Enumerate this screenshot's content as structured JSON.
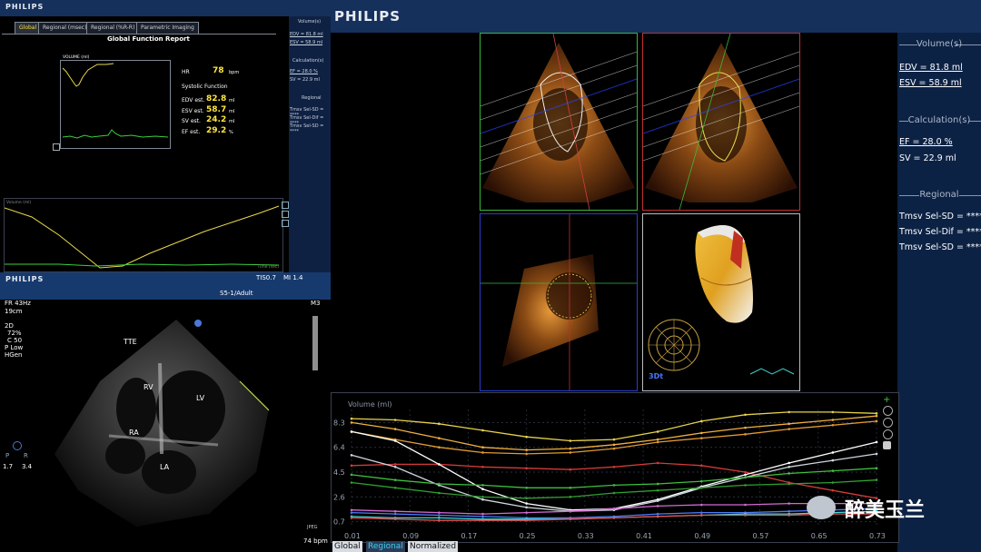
{
  "brand": "PHILIPS",
  "report": {
    "tabs": [
      "Global",
      "Regional (msec)",
      "Regional (%R-R)",
      "Parametric Imaging"
    ],
    "active_tab": 0,
    "title": "Global Function Report",
    "volume_label": "VOLUME (ml)",
    "hr_label": "HR",
    "hr_value": "78",
    "hr_unit": "bpm",
    "systolic_heading": "Systolic Function",
    "metrics": [
      {
        "label": "EDV est.",
        "value": "82.8",
        "unit": "ml"
      },
      {
        "label": "ESV est.",
        "value": "58.7",
        "unit": "ml"
      },
      {
        "label": "SV est.",
        "value": "24.2",
        "unit": "ml"
      },
      {
        "label": "EF est.",
        "value": "29.2",
        "unit": "%"
      }
    ],
    "side": {
      "volume_head": "Volume(s)",
      "edv": "EDV = 81.8 ml",
      "esv": "ESV = 58.9 ml",
      "calc_head": "Calculation(s)",
      "ef": "EF = 28.0 %",
      "sv": "SV = 22.9 ml",
      "regional_head": "Regional",
      "items": [
        "Tmsv Sel-SD = ****",
        "Tmsv Sel-Dif = ****",
        "Tmsv Sel-SD = ****"
      ]
    },
    "mini_axis": "Volume (ml)",
    "mini_time": "Time (sec)",
    "footer_tis": "TIS0.7",
    "footer_mi": "MI 1.4",
    "footer_preset": "S5-1/Adult"
  },
  "echo": {
    "fr": "FR 43Hz",
    "depth": "19cm",
    "mode": "2D",
    "gain": "72%",
    "comp": "C 50",
    "power": "P Low",
    "gen": "HGen",
    "m3": "M3",
    "probe": "TTE",
    "chambers": [
      "RV",
      "LV",
      "RA",
      "LA"
    ],
    "pr_p": "P",
    "pr_r": "R",
    "pr_left": "1.7",
    "pr_right": "3.4",
    "jpeg": "JPEG",
    "bpm": "74 bpm"
  },
  "main": {
    "side": {
      "volume_head": "Volume(s)",
      "edv": "EDV = 81.8 ml",
      "esv": "ESV = 58.9 ml",
      "calc_head": "Calculation(s)",
      "ef": "EF = 28.0 %",
      "sv": "SV = 22.9 ml",
      "regional_head": "Regional",
      "items": [
        "Tmsv Sel-SD = ****",
        "Tmsv Sel-Dif = ****",
        "Tmsv Sel-SD = ****"
      ]
    },
    "badge_3d": "3Dt",
    "bullseye_labels": [
      "1",
      "2",
      "3",
      "4",
      "5",
      "6"
    ],
    "bottom_tabs": [
      "Global",
      "Regional",
      "Normalized"
    ],
    "active_bottom_tab": 1,
    "watermark": "醉美玉兰"
  },
  "chart_data": {
    "type": "line",
    "ylabel": "Volume (ml)",
    "y_ticks": [
      "8.3",
      "6.4",
      "4.5",
      "2.6",
      "0.7"
    ],
    "x_ticks": [
      "0.01",
      "0.09",
      "0.17",
      "0.25",
      "0.33",
      "0.41",
      "0.49",
      "0.57",
      "0.65",
      "0.73"
    ],
    "ylim": [
      0.4,
      9.3
    ],
    "xlim": [
      0.01,
      0.73
    ],
    "series": [
      {
        "color": "#e6d34a",
        "values": [
          8.6,
          8.5,
          8.2,
          7.7,
          7.2,
          6.9,
          7.0,
          7.6,
          8.4,
          8.9,
          9.1,
          9.1,
          9.0
        ]
      },
      {
        "color": "#f0b040",
        "values": [
          8.3,
          7.8,
          7.1,
          6.4,
          6.2,
          6.3,
          6.6,
          7.0,
          7.5,
          7.9,
          8.2,
          8.5,
          8.8
        ]
      },
      {
        "color": "#e09a30",
        "values": [
          7.6,
          7.0,
          6.4,
          6.0,
          5.9,
          6.0,
          6.3,
          6.8,
          7.1,
          7.4,
          7.8,
          8.1,
          8.4
        ]
      },
      {
        "color": "#d43a3a",
        "values": [
          5.0,
          5.1,
          5.1,
          4.9,
          4.8,
          4.7,
          4.9,
          5.2,
          5.0,
          4.5,
          3.7,
          3.1,
          2.5
        ]
      },
      {
        "color": "#ffffff",
        "values": [
          7.6,
          6.9,
          5.1,
          3.2,
          2.1,
          1.6,
          1.7,
          2.4,
          3.4,
          4.3,
          5.2,
          6.0,
          6.8
        ]
      },
      {
        "color": "#cfd6e0",
        "values": [
          5.8,
          4.9,
          3.5,
          2.4,
          1.8,
          1.5,
          1.6,
          2.3,
          3.3,
          4.1,
          4.9,
          5.4,
          5.9
        ]
      },
      {
        "color": "#3fbf3f",
        "values": [
          4.3,
          3.9,
          3.6,
          3.5,
          3.3,
          3.3,
          3.5,
          3.6,
          3.8,
          4.1,
          4.4,
          4.6,
          4.8
        ]
      },
      {
        "color": "#2fa02f",
        "values": [
          3.7,
          3.3,
          2.9,
          2.6,
          2.5,
          2.6,
          2.9,
          3.1,
          3.3,
          3.5,
          3.6,
          3.7,
          3.9
        ]
      },
      {
        "color": "#d46ad4",
        "values": [
          1.6,
          1.5,
          1.4,
          1.3,
          1.4,
          1.5,
          1.7,
          1.9,
          2.0,
          2.0,
          2.1,
          2.1,
          2.1
        ]
      },
      {
        "color": "#4d7dff",
        "values": [
          1.4,
          1.3,
          1.2,
          1.1,
          1.0,
          1.0,
          1.1,
          1.3,
          1.4,
          1.4,
          1.5,
          1.6,
          1.7
        ]
      },
      {
        "color": "#40d8d8",
        "values": [
          1.1,
          1.0,
          1.0,
          0.9,
          0.9,
          0.9,
          1.0,
          1.1,
          1.2,
          1.3,
          1.3,
          1.4,
          1.5
        ]
      },
      {
        "color": "#e85050",
        "values": [
          1.0,
          0.9,
          0.8,
          0.8,
          0.8,
          0.9,
          1.0,
          1.1,
          1.2,
          1.2,
          1.2,
          1.3,
          1.3
        ]
      }
    ]
  }
}
